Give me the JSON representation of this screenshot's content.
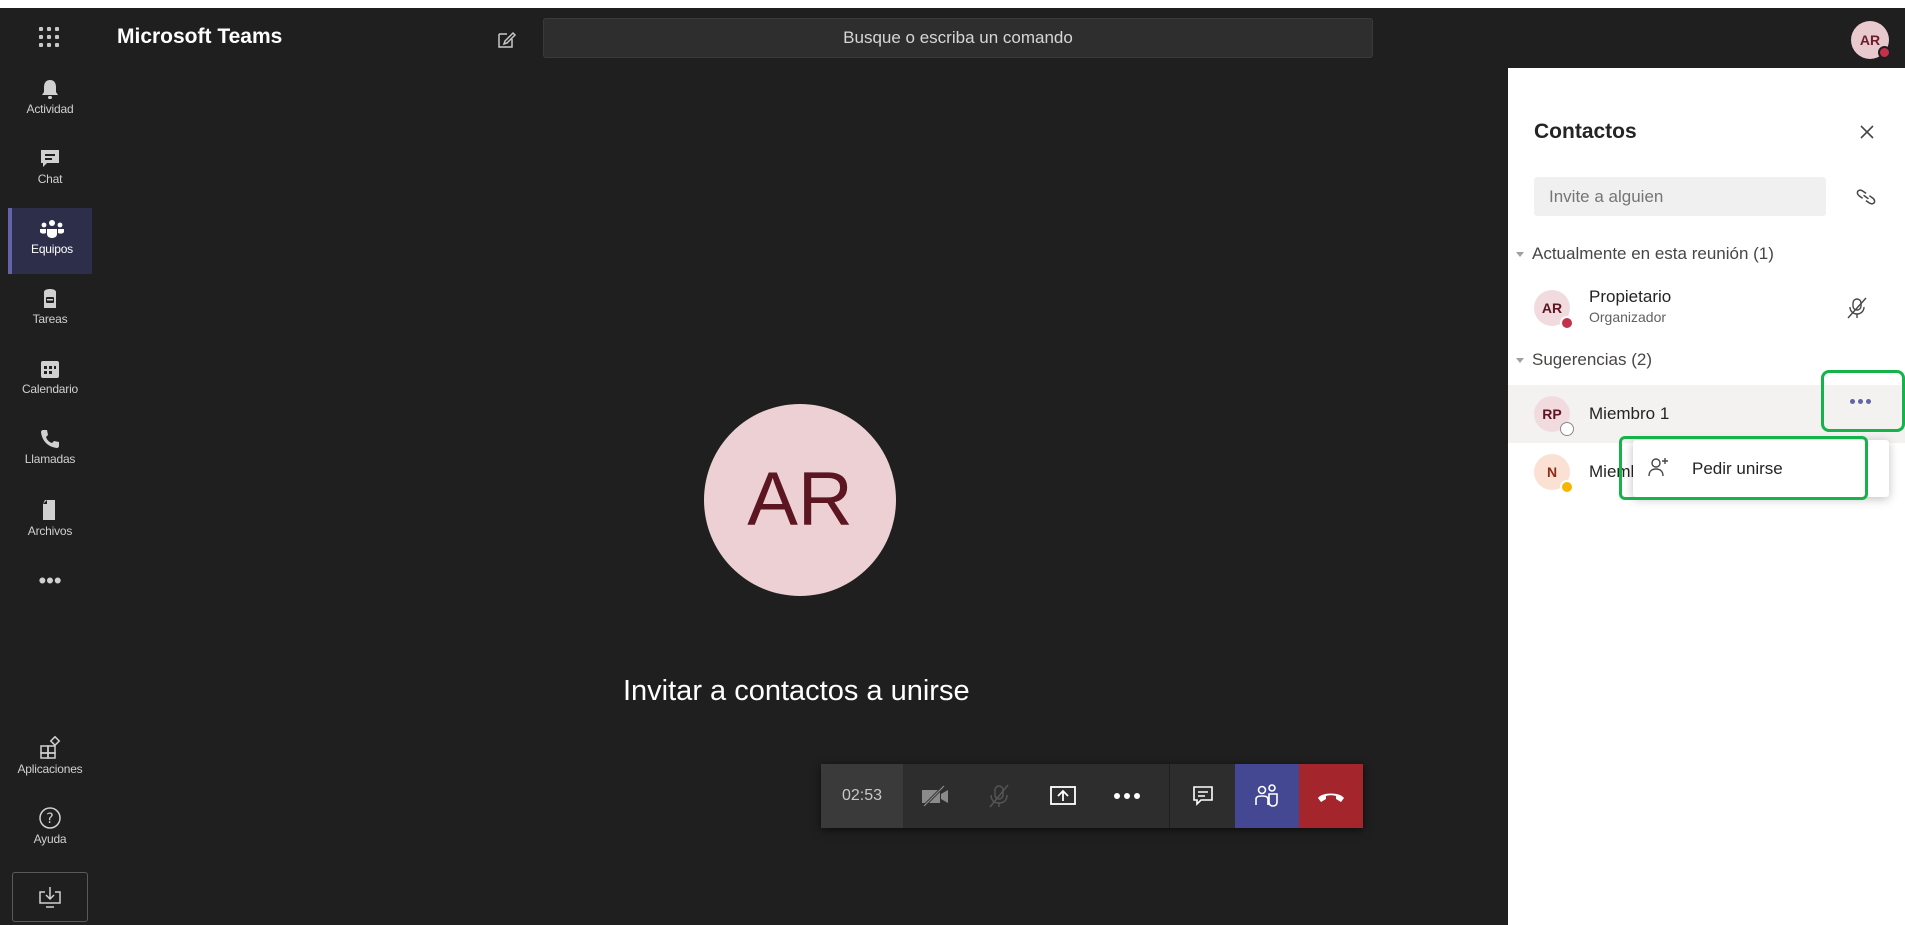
{
  "app": {
    "title": "Microsoft Teams"
  },
  "search": {
    "placeholder": "Busque o escriba un comando"
  },
  "user": {
    "initials": "AR"
  },
  "rail": {
    "items": [
      {
        "label": "Actividad",
        "icon": "bell-icon"
      },
      {
        "label": "Chat",
        "icon": "chat-icon"
      },
      {
        "label": "Equipos",
        "icon": "teams-icon",
        "active": true
      },
      {
        "label": "Tareas",
        "icon": "tasks-icon"
      },
      {
        "label": "Calendario",
        "icon": "calendar-icon"
      },
      {
        "label": "Llamadas",
        "icon": "phone-icon"
      },
      {
        "label": "Archivos",
        "icon": "files-icon"
      }
    ],
    "more": "•••",
    "bottom": [
      {
        "label": "Aplicaciones",
        "icon": "apps-icon"
      },
      {
        "label": "Ayuda",
        "icon": "help-icon"
      }
    ]
  },
  "stage": {
    "avatar_initials": "AR",
    "invite_text": "Invitar a contactos a unirse"
  },
  "controls": {
    "timer": "02:53",
    "buttons": [
      "camera-off-icon",
      "mic-off-icon",
      "share-screen-icon",
      "more-icon",
      "chat-icon",
      "participants-icon",
      "hang-up-icon"
    ]
  },
  "panel": {
    "title": "Contactos",
    "invite_placeholder": "Invite a alguien",
    "in_meeting_header": "Actualmente en esta reunión (1)",
    "owner": {
      "initials": "AR",
      "name": "Propietario",
      "role": "Organizador"
    },
    "suggestions_header": "Sugerencias (2)",
    "suggestions": [
      {
        "initials": "RP",
        "name": "Miembro 1"
      },
      {
        "initials": "N",
        "name": "Miembro 2"
      }
    ],
    "menu_item": "Pedir unirse"
  },
  "colors": {
    "accent": "#6264a7",
    "hangup": "#a4262c",
    "highlight": "#15b34a",
    "status_busy": "#c4314b",
    "status_away": "#f8b500"
  }
}
